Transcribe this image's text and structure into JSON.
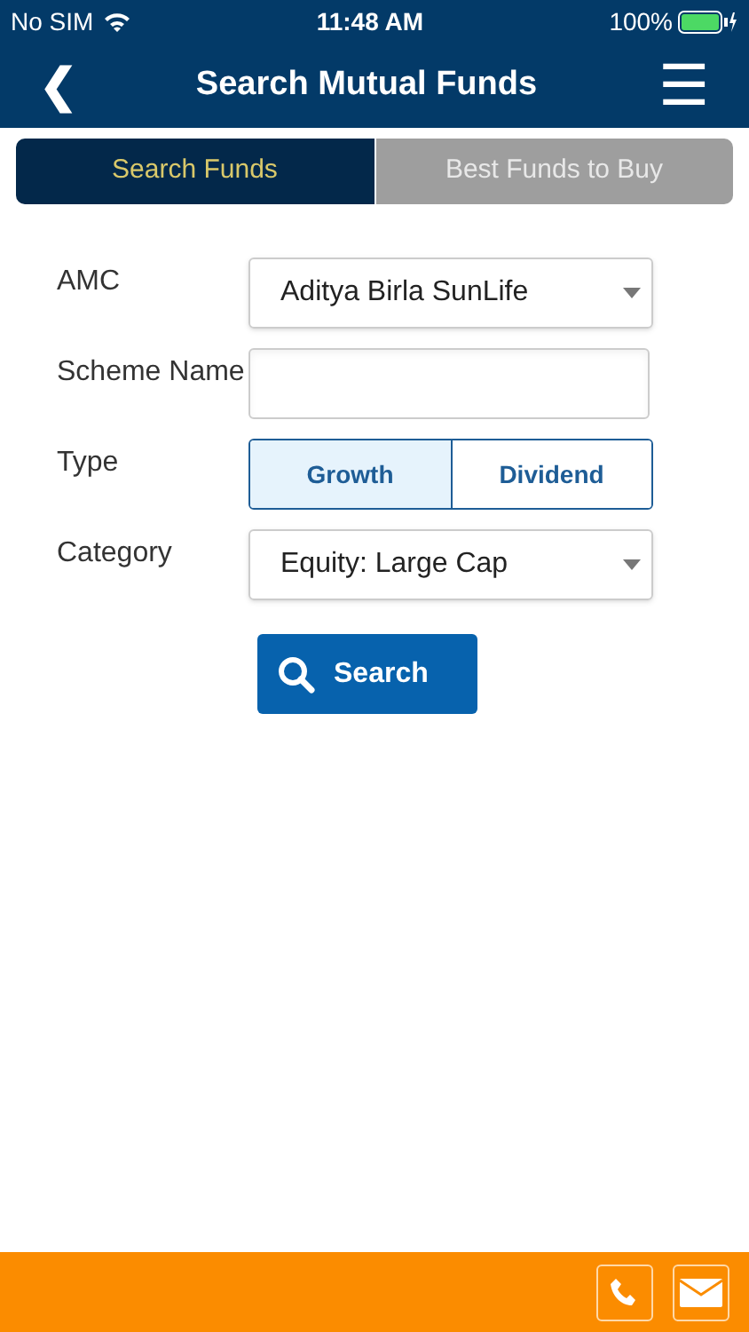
{
  "status_bar": {
    "carrier": "No SIM",
    "time": "11:48 AM",
    "battery": "100%"
  },
  "header": {
    "back": "❮",
    "title": "Search Mutual Funds",
    "menu": "☰"
  },
  "tabs": [
    {
      "label": "Search Funds",
      "selected": true
    },
    {
      "label": "Best Funds to Buy",
      "selected": false
    }
  ],
  "form": {
    "amc": {
      "label": "AMC",
      "value": "Aditya Birla SunLife"
    },
    "scheme_name": {
      "label": "Scheme Name"
    },
    "type": {
      "label": "Type",
      "options": [
        {
          "label": "Growth",
          "selected": true
        },
        {
          "label": "Dividend",
          "selected": false
        }
      ]
    },
    "category": {
      "label": "Category",
      "value": "Equity: Large Cap"
    },
    "search_button": "Search"
  }
}
